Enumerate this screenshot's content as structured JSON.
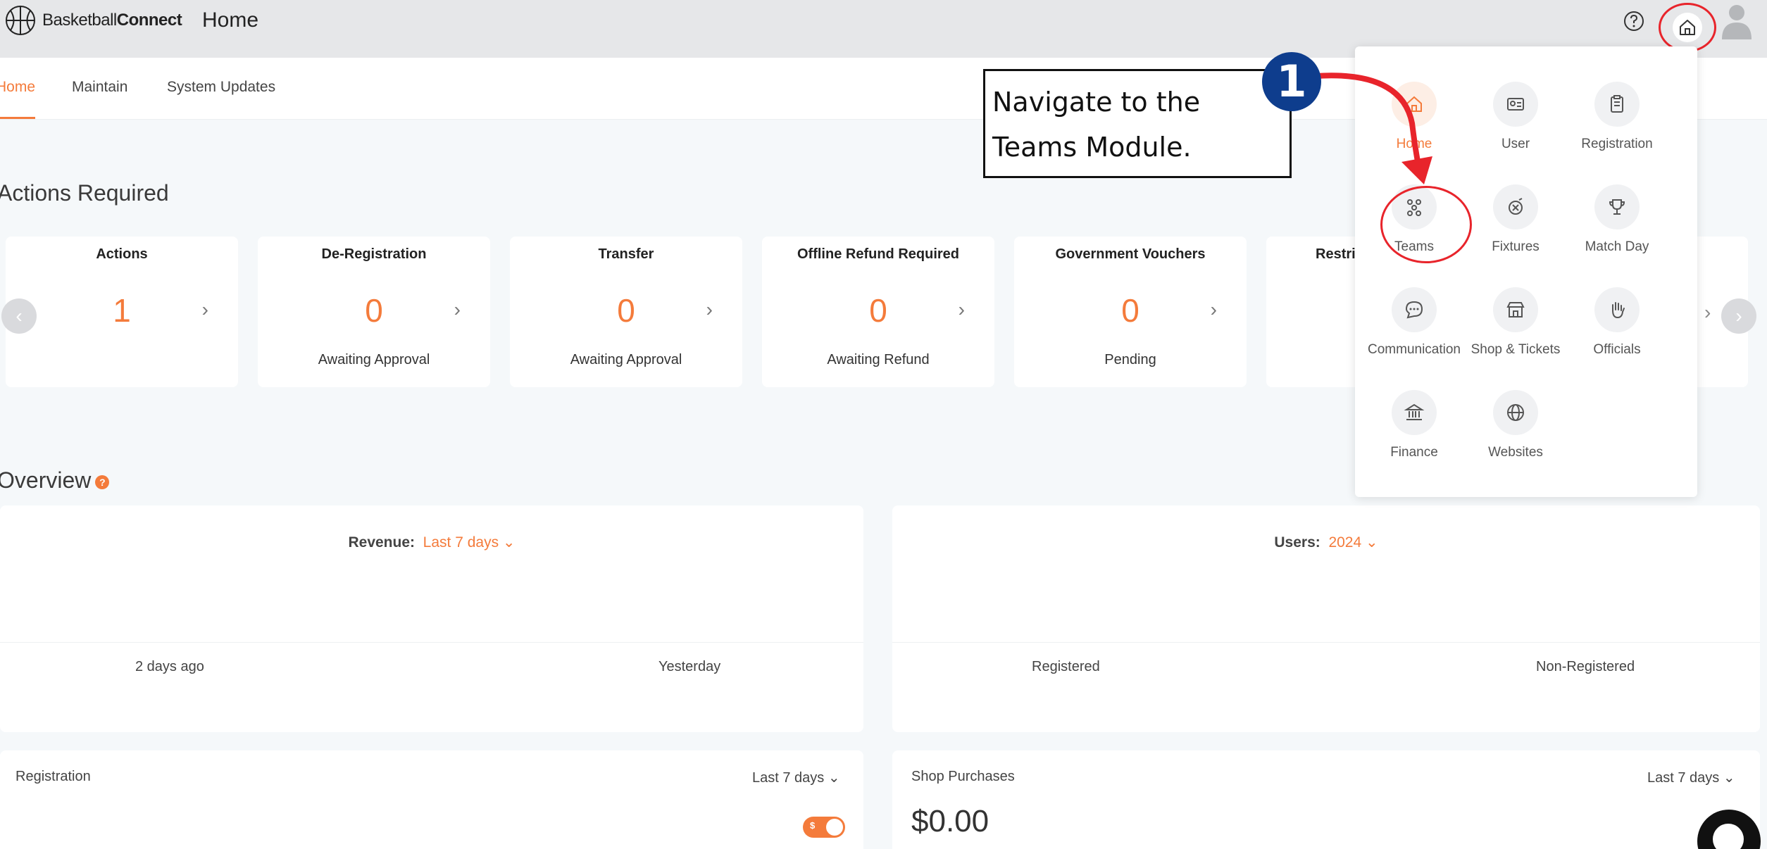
{
  "header": {
    "logo_text_regular": "Basketball",
    "logo_text_bold": "Connect",
    "page_title": "Home",
    "icons": [
      "basketball-logo-icon",
      "help-icon",
      "home-icon",
      "avatar-icon"
    ]
  },
  "tabs": [
    {
      "label": "Home",
      "active": true
    },
    {
      "label": "Maintain",
      "active": false
    },
    {
      "label": "System Updates",
      "active": false
    }
  ],
  "actions_required": {
    "title": "Actions Required",
    "cards": [
      {
        "title": "Actions",
        "count": "1",
        "sub": ""
      },
      {
        "title": "De-Registration",
        "count": "0",
        "sub": "Awaiting Approval"
      },
      {
        "title": "Transfer",
        "count": "0",
        "sub": "Awaiting Approval"
      },
      {
        "title": "Offline Refund Required",
        "count": "0",
        "sub": "Awaiting Refund"
      },
      {
        "title": "Government Vouchers",
        "count": "0",
        "sub": "Pending"
      },
      {
        "title": "Restri",
        "count": "",
        "sub": ""
      }
    ]
  },
  "overview": {
    "title": "Overview",
    "help_badge": "?",
    "revenue": {
      "label": "Revenue:",
      "period": "Last 7 days",
      "columns": [
        "2 days ago",
        "Yesterday"
      ]
    },
    "users": {
      "label": "Users:",
      "period": "2024",
      "columns": [
        "Registered",
        "Non-Registered"
      ]
    },
    "registration": {
      "title": "Registration",
      "period": "Last 7 days",
      "toggle_label": "$"
    },
    "shop_purchases": {
      "title": "Shop Purchases",
      "period": "Last 7 days",
      "amount": "$0.00"
    }
  },
  "annotation": {
    "step_number": "1",
    "callout_line1": "Navigate to the",
    "callout_line2": "Teams Module."
  },
  "module_menu": [
    {
      "name": "Home",
      "icon": "home-icon",
      "active": true
    },
    {
      "name": "User",
      "icon": "user-card-icon",
      "active": false
    },
    {
      "name": "Registration",
      "icon": "clipboard-icon",
      "active": false
    },
    {
      "name": "Teams",
      "icon": "teams-icon",
      "active": false
    },
    {
      "name": "Fixtures",
      "icon": "fixtures-icon",
      "active": false
    },
    {
      "name": "Match Day",
      "icon": "trophy-icon",
      "active": false
    },
    {
      "name": "Communication",
      "icon": "chat-icon",
      "active": false
    },
    {
      "name": "Shop & Tickets",
      "icon": "shop-icon",
      "active": false
    },
    {
      "name": "Officials",
      "icon": "hand-icon",
      "active": false
    },
    {
      "name": "Finance",
      "icon": "bank-icon",
      "active": false
    },
    {
      "name": "Websites",
      "icon": "globe-icon",
      "active": false
    }
  ],
  "colors": {
    "accent": "#f47b3b",
    "highlight_red": "#e8242b",
    "step_blue": "#0e3d8d"
  }
}
